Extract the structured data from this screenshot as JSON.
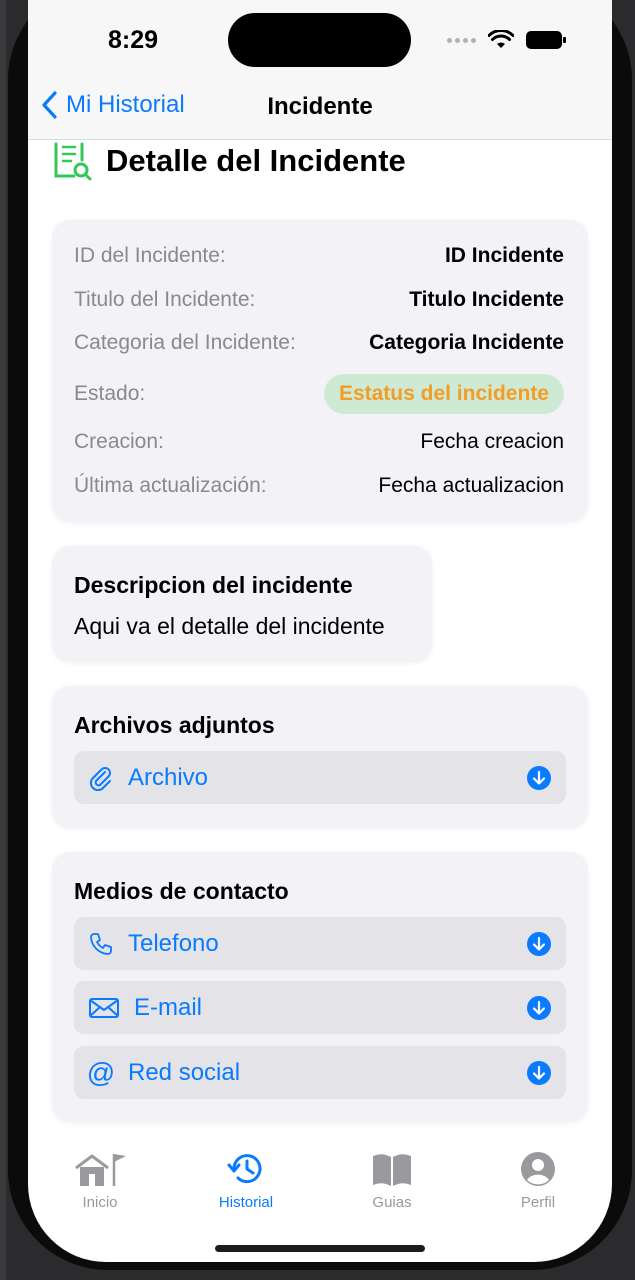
{
  "status_bar": {
    "time": "8:29"
  },
  "nav": {
    "back_label": "Mi Historial",
    "title": "Incidente"
  },
  "header": {
    "title": "Detalle del Incidente"
  },
  "details": {
    "rows": [
      {
        "label": "ID del Incidente:",
        "value": "ID Incidente"
      },
      {
        "label": "Titulo del Incidente:",
        "value": "Titulo Incidente"
      },
      {
        "label": "Categoria del Incidente:",
        "value": "Categoria Incidente"
      },
      {
        "label": "Estado:",
        "value": "Estatus del incidente"
      },
      {
        "label": "Creacion:",
        "value": "Fecha creacion"
      },
      {
        "label": "Última actualización:",
        "value": "Fecha actualizacion"
      }
    ],
    "status_colors": {
      "pill_bg": "#cfead4",
      "pill_text": "#f39d26"
    }
  },
  "description": {
    "title": "Descripcion del incidente",
    "text": "Aqui va el detalle del incidente"
  },
  "attachments": {
    "title": "Archivos adjuntos",
    "items": [
      {
        "label": "Archivo",
        "icon": "paperclip-icon"
      }
    ]
  },
  "contact": {
    "title": "Medios de contacto",
    "items": [
      {
        "label": "Telefono",
        "icon": "phone-icon"
      },
      {
        "label": "E-mail",
        "icon": "envelope-icon"
      },
      {
        "label": "Red social",
        "icon": "at-sign-icon"
      }
    ]
  },
  "tabbar": {
    "tabs": [
      {
        "label": "Inicio",
        "icon": "home-flag-icon",
        "active": false
      },
      {
        "label": "Historial",
        "icon": "clock-history-icon",
        "active": true
      },
      {
        "label": "Guias",
        "icon": "book-icon",
        "active": false
      },
      {
        "label": "Perfil",
        "icon": "person-circle-icon",
        "active": false
      }
    ]
  },
  "colors": {
    "accent": "#0a7aff",
    "header_icon": "#34c759"
  }
}
